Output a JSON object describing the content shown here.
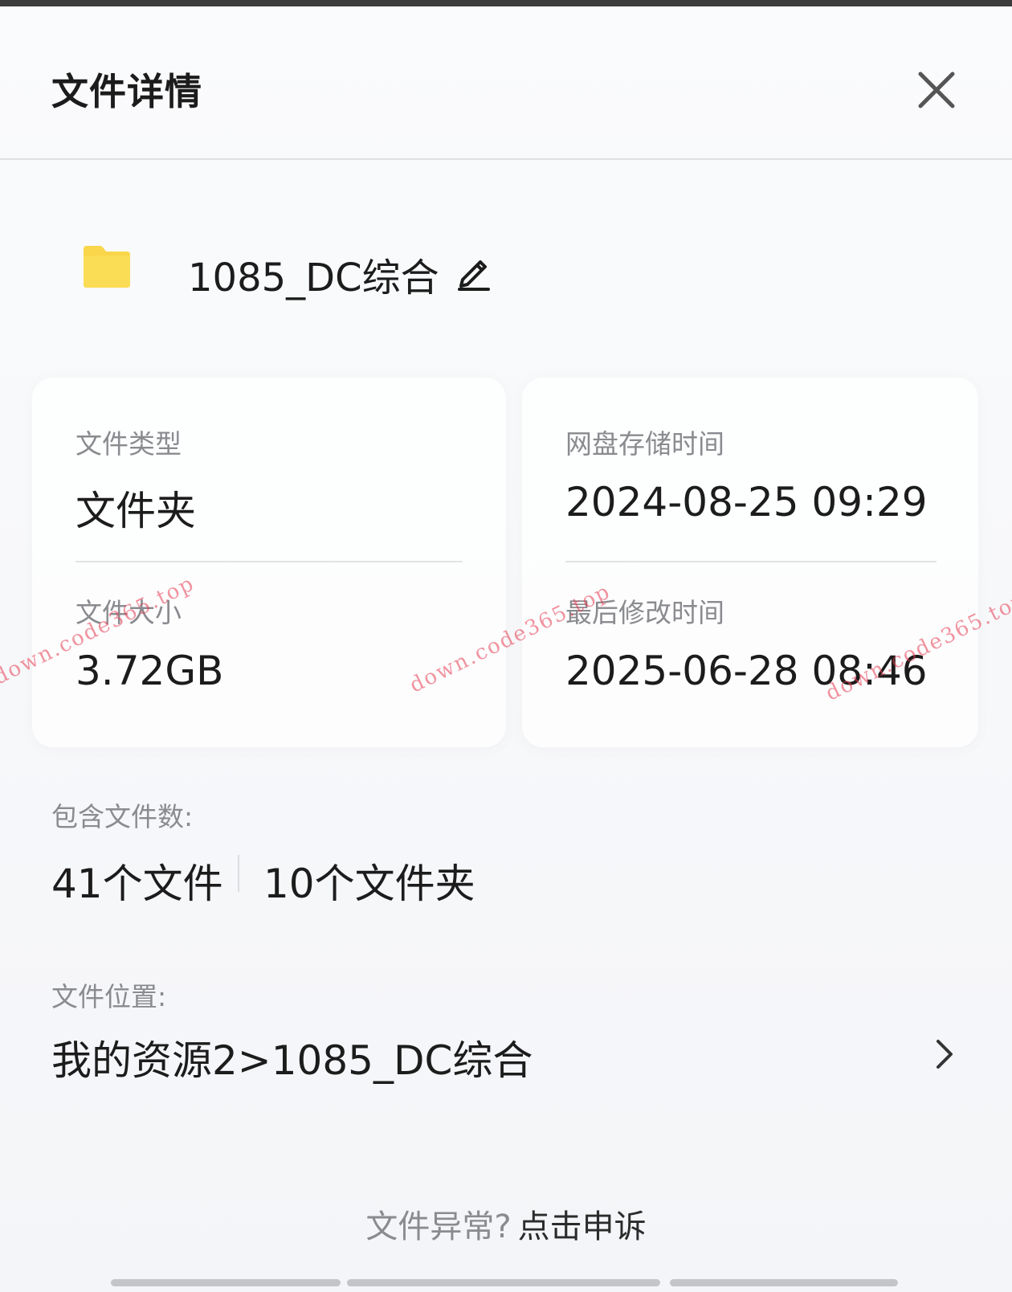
{
  "header": {
    "title": "文件详情"
  },
  "file": {
    "name": "1085_DC综合",
    "icon": "folder-icon",
    "icon_color": "#F9D64A"
  },
  "details": {
    "type": {
      "label": "文件类型",
      "value": "文件夹"
    },
    "size": {
      "label": "文件大小",
      "value": "3.72GB"
    },
    "stored_time": {
      "label": "网盘存储时间",
      "value": "2024-08-25 09:29"
    },
    "modified_time": {
      "label": "最后修改时间",
      "value": "2025-06-28 08:46"
    }
  },
  "contents": {
    "label": "包含文件数:",
    "files": "41个文件",
    "folders": "10个文件夹"
  },
  "location": {
    "label": "文件位置:",
    "path": "我的资源2>1085_DC综合"
  },
  "footer": {
    "question": "文件异常?",
    "link": "点击申诉"
  },
  "watermark": {
    "text": "down.code365.top"
  },
  "colors": {
    "text_primary": "#1c1c1c",
    "text_secondary": "#8a8b8f",
    "divider": "#e2e3e6",
    "watermark": "#e63c50"
  }
}
